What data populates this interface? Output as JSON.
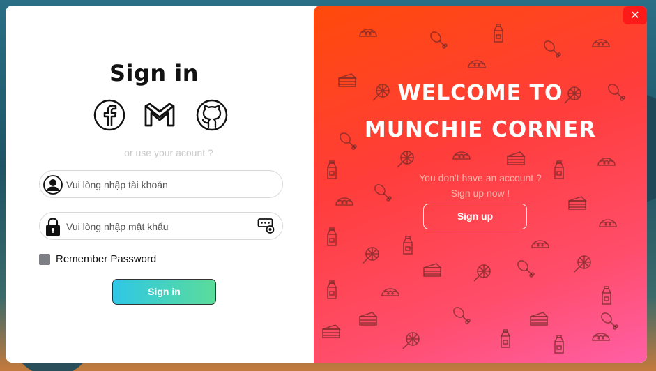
{
  "signin": {
    "title": "Sign in",
    "or_text": "or use your acount ?",
    "username_placeholder": "Vui lòng nhập tài khoản",
    "password_placeholder": "Vui lòng nhập mật khẩu",
    "remember_label": "Remember Password",
    "button_label": "Sign in",
    "social_icons": [
      "facebook-icon",
      "gmail-icon",
      "github-icon"
    ]
  },
  "welcome": {
    "line1": "Welcome to",
    "line2": "Munchie Corner",
    "no_account": "You don't have an account ?",
    "signup_now": "Sign up now !",
    "signup_button": "Sign up"
  },
  "window": {
    "close_icon": "close-icon"
  },
  "colors": {
    "accent_gradient_start": "#ff4a0a",
    "accent_gradient_end": "#ff5fa6",
    "signin_gradient_start": "#2fc7e6",
    "signin_gradient_end": "#5bdc9a",
    "close": "#ff1a1a"
  }
}
